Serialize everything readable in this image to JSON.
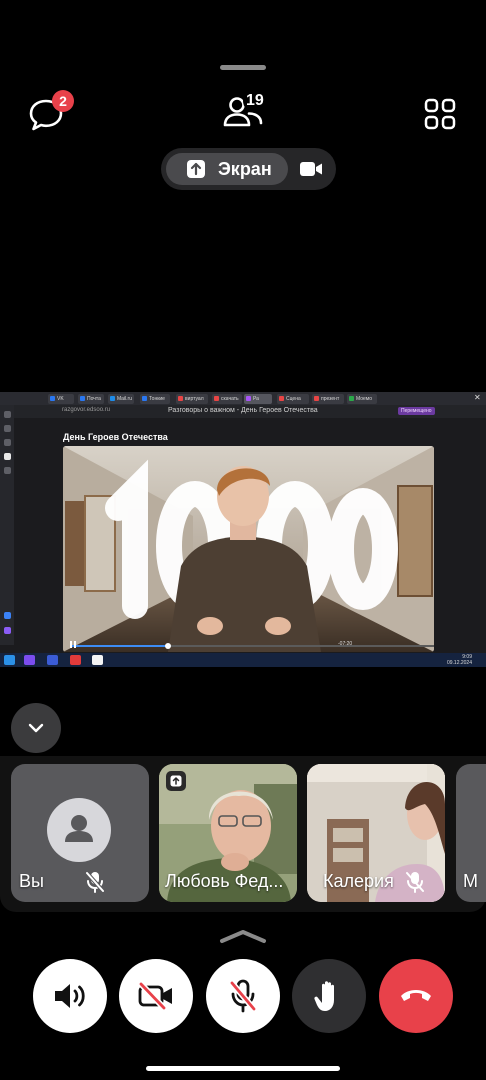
{
  "top": {
    "chat_badge": "2",
    "participants_count": "19",
    "screen_button_label": "Экран"
  },
  "shared_screen": {
    "browser_tabs": [
      "VK",
      "Почта",
      "Mail.ru",
      "Тонкие",
      "виртуал",
      "скачать",
      "Ра",
      "Сцена",
      "презент",
      "Моемо"
    ],
    "url": "razgovor.edsoo.ru",
    "page_title": "Разговоры о важном - День Героев Отечества",
    "profile_label": "Перемещено",
    "heading": "День Героев Отечества",
    "video_overlay_number": "1000",
    "video_time": "-07:20",
    "progress_fraction": 0.27,
    "clock_time": "9:09",
    "clock_date": "09.12.2024"
  },
  "participants": [
    {
      "name": "Вы",
      "mic_muted": true,
      "avatar": "person-icon"
    },
    {
      "name": "Любовь Фед...",
      "sharing_screen": true
    },
    {
      "name": "Калерия",
      "mic_muted": true
    },
    {
      "name": "М"
    }
  ],
  "controls": [
    {
      "name": "speaker-button",
      "icon": "speaker-icon",
      "bg": "#ffffff"
    },
    {
      "name": "camera-off-button",
      "icon": "camera-off-icon",
      "bg": "#ffffff"
    },
    {
      "name": "mic-off-button",
      "icon": "mic-off-icon",
      "bg": "#ffffff"
    },
    {
      "name": "raise-hand-button",
      "icon": "hand-icon",
      "bg": "#2f2f31"
    },
    {
      "name": "hang-up-button",
      "icon": "phone-hangup-icon",
      "bg": "#e8414a"
    }
  ],
  "colors": {
    "accent_red": "#e8414a",
    "progress_blue": "#3d8df5"
  }
}
